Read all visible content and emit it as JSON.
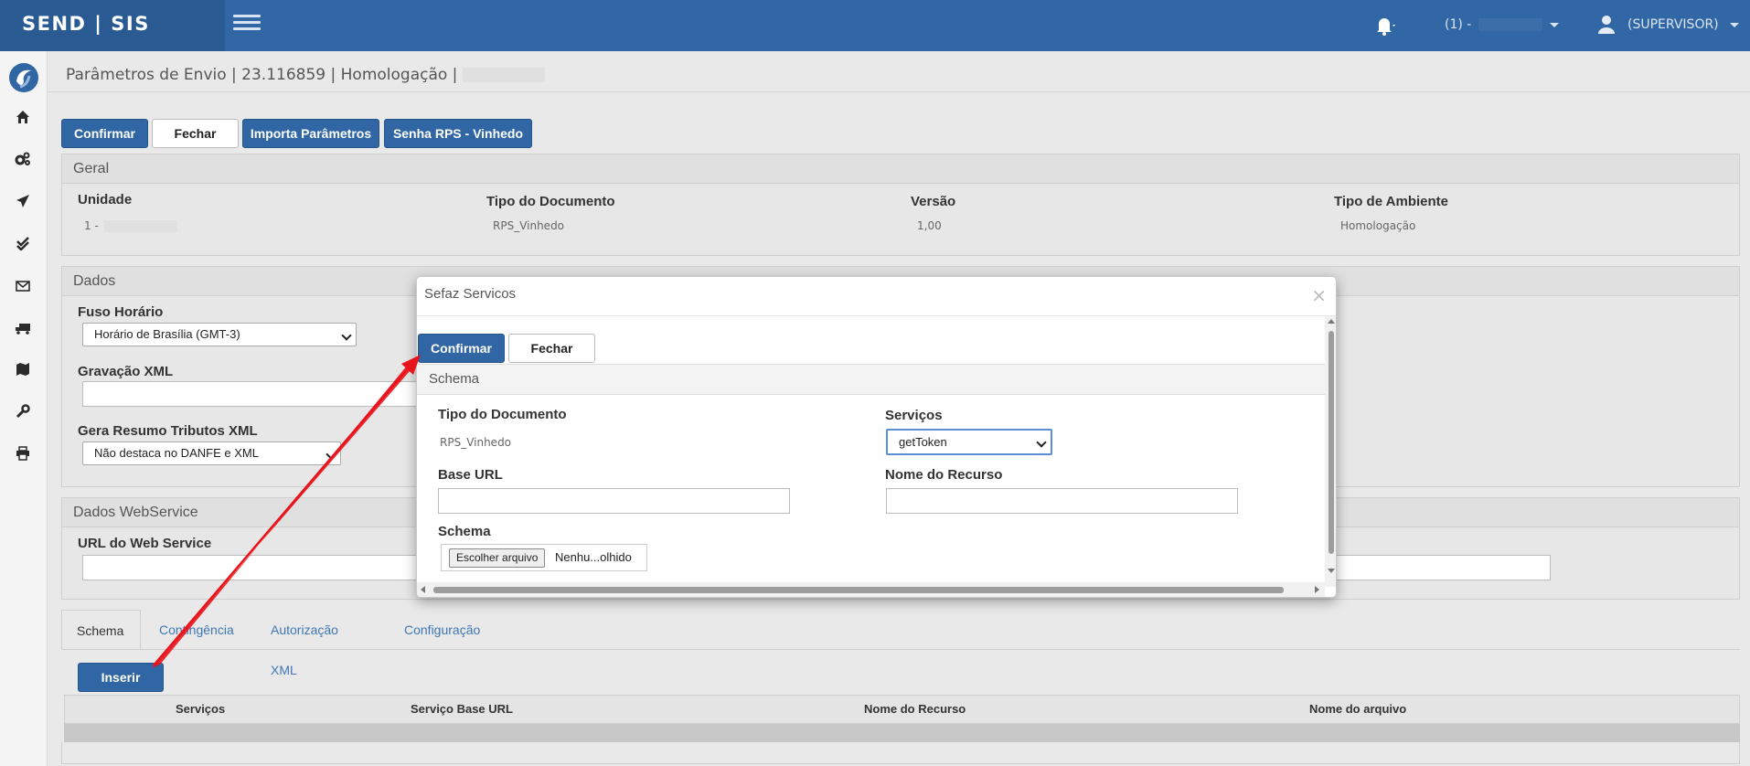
{
  "topbar": {
    "brand": "SEND | SIS",
    "unit_prefix": "(1) -",
    "user": "(SUPERVISOR)"
  },
  "breadcrumb": "Parâmetros de Envio | 23.116859 | Homologação |",
  "toolbar": {
    "confirm": "Confirmar",
    "close": "Fechar",
    "import": "Importa Parâmetros",
    "password": "Senha RPS - Vinhedo"
  },
  "geral": {
    "title": "Geral",
    "unidade_label": "Unidade",
    "unidade_value": "1 -",
    "tipo_doc_label": "Tipo do Documento",
    "tipo_doc_value": "RPS_Vinhedo",
    "versao_label": "Versão",
    "versao_value": "1,00",
    "ambiente_label": "Tipo de Ambiente",
    "ambiente_value": "Homologação"
  },
  "dados": {
    "title": "Dados",
    "fuso_label": "Fuso Horário",
    "fuso_value": "Horário de Brasília (GMT-3)",
    "gravacao_label": "Gravação XML",
    "resumo_label": "Gera Resumo Tributos XML",
    "resumo_value": "Não destaca no DANFE e XML"
  },
  "webservice": {
    "title": "Dados WebService",
    "url_label": "URL do Web Service"
  },
  "tabs": [
    "Schema",
    "Contingência",
    "Autorização XML",
    "Configuração"
  ],
  "insert_button": "Inserir",
  "grid_headers": [
    "Serviços",
    "Serviço Base URL",
    "Nome do Recurso",
    "Nome do arquivo"
  ],
  "modal": {
    "title": "Sefaz Servicos",
    "close_glyph": "×",
    "confirm": "Confirmar",
    "close": "Fechar",
    "section": "Schema",
    "tipo_doc_label": "Tipo do Documento",
    "tipo_doc_value": "RPS_Vinhedo",
    "servicos_label": "Serviços",
    "servicos_value": "getToken",
    "base_url_label": "Base URL",
    "recurso_label": "Nome do Recurso",
    "schema_label": "Schema",
    "file_button": "Escolher arquivo",
    "file_text": "Nenhu...olhido"
  },
  "colors": {
    "topbar": "#3167a4",
    "primary_button": "#2f66a3",
    "annotation_arrow": "#e8141c"
  },
  "icons": [
    "bell-icon",
    "user-icon",
    "home-icon",
    "cogs-icon",
    "send-icon",
    "check-icon",
    "envelope-icon",
    "truck-icon",
    "map-icon",
    "wrench-icon",
    "print-icon"
  ]
}
